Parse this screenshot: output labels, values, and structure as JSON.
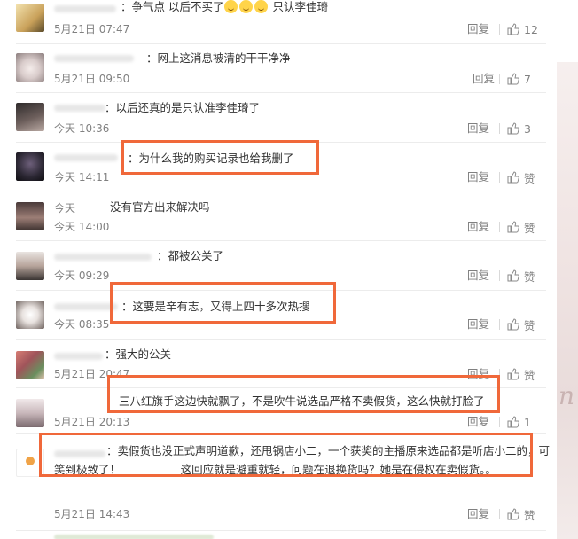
{
  "ui": {
    "reply_label": "回复",
    "like_icon": "thumbs-up-icon",
    "accent": "#f0683a",
    "name_color": "#eb7350"
  },
  "comments": [
    {
      "time": "5月21日 07:47",
      "text": "争气点  以后不买了",
      "text_tail": "只认李佳琦",
      "likes": "12"
    },
    {
      "time": "5月21日 09:50",
      "text": "网上这消息被清的干干净净",
      "likes": "7"
    },
    {
      "time": "今天 10:36",
      "text": "以后还真的是只认准李佳琦了",
      "likes": "3"
    },
    {
      "time": "今天 14:11",
      "text": "为什么我的购买记录也给我删了",
      "likes": "赞"
    },
    {
      "time": "今天 14:00",
      "name_time": "今天",
      "text": "没有官方出来解决吗",
      "likes": "赞"
    },
    {
      "time": "今天 09:29",
      "text": "都被公关了",
      "likes": "赞"
    },
    {
      "time": "今天 08:35",
      "text": "这要是辛有志，又得上四十多次热搜",
      "likes": "赞"
    },
    {
      "time": "5月21日 20:47",
      "text": "强大的公关",
      "likes": "赞"
    },
    {
      "time": "5月21日 20:13",
      "text": "三八红旗手这边快就飘了，不是吹牛说选品严格不卖假货，这么快就打脸了",
      "likes": "1"
    },
    {
      "time": "5月21日 14:43",
      "text": "卖假货也没正式声明道歉，还甩锅店小二，一个获奖的主播原来选品都是听店小二的，可笑到极致了！",
      "text2": "这回应就是避重就轻，问题在退换货吗？她是在侵权在卖假货。。",
      "likes": "赞"
    }
  ]
}
